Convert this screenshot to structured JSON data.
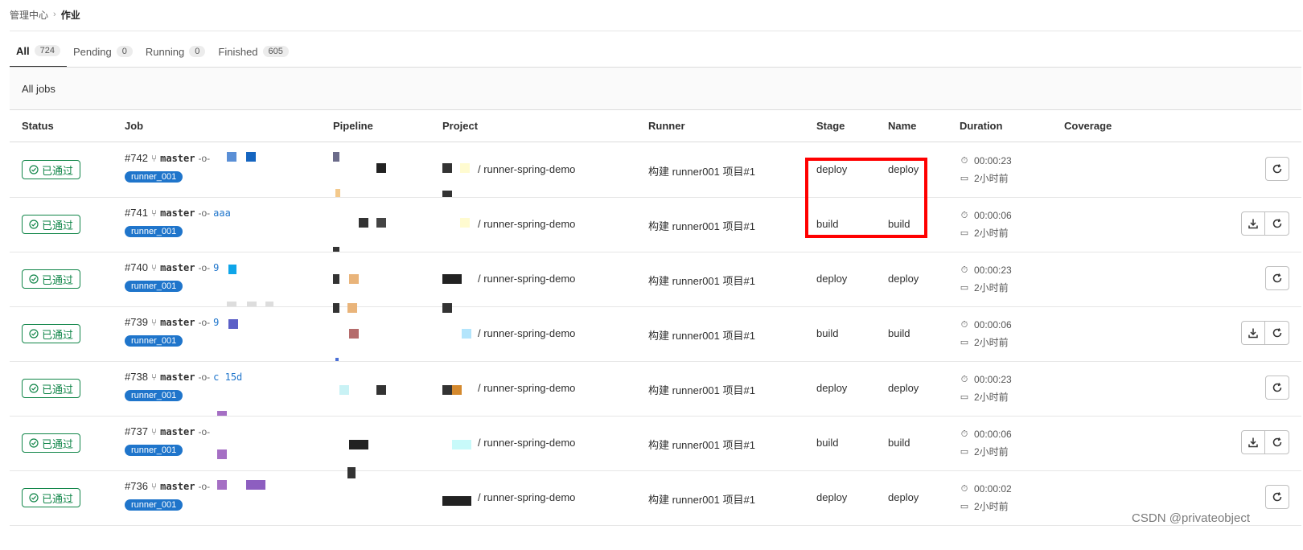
{
  "breadcrumb": {
    "root": "管理中心",
    "separator": "›",
    "current": "作业"
  },
  "tabs": [
    {
      "label": "All",
      "count": "724"
    },
    {
      "label": "Pending",
      "count": "0"
    },
    {
      "label": "Running",
      "count": "0"
    },
    {
      "label": "Finished",
      "count": "605"
    }
  ],
  "section_title": "All jobs",
  "columns": {
    "status": "Status",
    "job": "Job",
    "pipeline": "Pipeline",
    "project": "Project",
    "runner": "Runner",
    "stage": "Stage",
    "name": "Name",
    "duration": "Duration",
    "coverage": "Coverage"
  },
  "jobs": [
    {
      "status": "已通过",
      "id": "#742",
      "branch": "master",
      "sha": "",
      "tag": "runner_001",
      "project": "/ runner-spring-demo",
      "runner": "构建 runner001 项目#1",
      "stage": "deploy",
      "name": "deploy",
      "duration": "00:00:23",
      "finished": "2小时前",
      "download": false
    },
    {
      "status": "已通过",
      "id": "#741",
      "branch": "master",
      "sha": "aaa",
      "tag": "runner_001",
      "project": "/ runner-spring-demo",
      "runner": "构建 runner001 项目#1",
      "stage": "build",
      "name": "build",
      "duration": "00:00:06",
      "finished": "2小时前",
      "download": true
    },
    {
      "status": "已通过",
      "id": "#740",
      "branch": "master",
      "sha": "9",
      "tag": "runner_001",
      "project": "/ runner-spring-demo",
      "runner": "构建 runner001 项目#1",
      "stage": "deploy",
      "name": "deploy",
      "duration": "00:00:23",
      "finished": "2小时前",
      "download": false
    },
    {
      "status": "已通过",
      "id": "#739",
      "branch": "master",
      "sha": "9",
      "tag": "runner_001",
      "project": "/ runner-spring-demo",
      "runner": "构建 runner001 项目#1",
      "stage": "build",
      "name": "build",
      "duration": "00:00:06",
      "finished": "2小时前",
      "download": true
    },
    {
      "status": "已通过",
      "id": "#738",
      "branch": "master",
      "sha": "c 15d",
      "tag": "runner_001",
      "project": "/ runner-spring-demo",
      "runner": "构建 runner001 项目#1",
      "stage": "deploy",
      "name": "deploy",
      "duration": "00:00:23",
      "finished": "2小时前",
      "download": false
    },
    {
      "status": "已通过",
      "id": "#737",
      "branch": "master",
      "sha": "",
      "tag": "runner_001",
      "project": "/ runner-spring-demo",
      "runner": "构建 runner001 项目#1",
      "stage": "build",
      "name": "build",
      "duration": "00:00:06",
      "finished": "2小时前",
      "download": true
    },
    {
      "status": "已通过",
      "id": "#736",
      "branch": "master",
      "sha": "",
      "tag": "runner_001",
      "project": "/ runner-spring-demo",
      "runner": "构建 runner001 项目#1",
      "stage": "deploy",
      "name": "deploy",
      "duration": "00:00:02",
      "finished": "2小时前",
      "download": false
    }
  ],
  "icons": {
    "branch": "branch-icon",
    "commit": "commit-icon",
    "status": "check-circle-icon",
    "timer": "timer-icon",
    "calendar": "calendar-icon",
    "download": "download-icon",
    "retry": "retry-icon"
  },
  "colors": {
    "success": "#108548",
    "tag": "#1f75cb",
    "highlight": "#ff0000"
  },
  "watermark": "CSDN @privateobject"
}
